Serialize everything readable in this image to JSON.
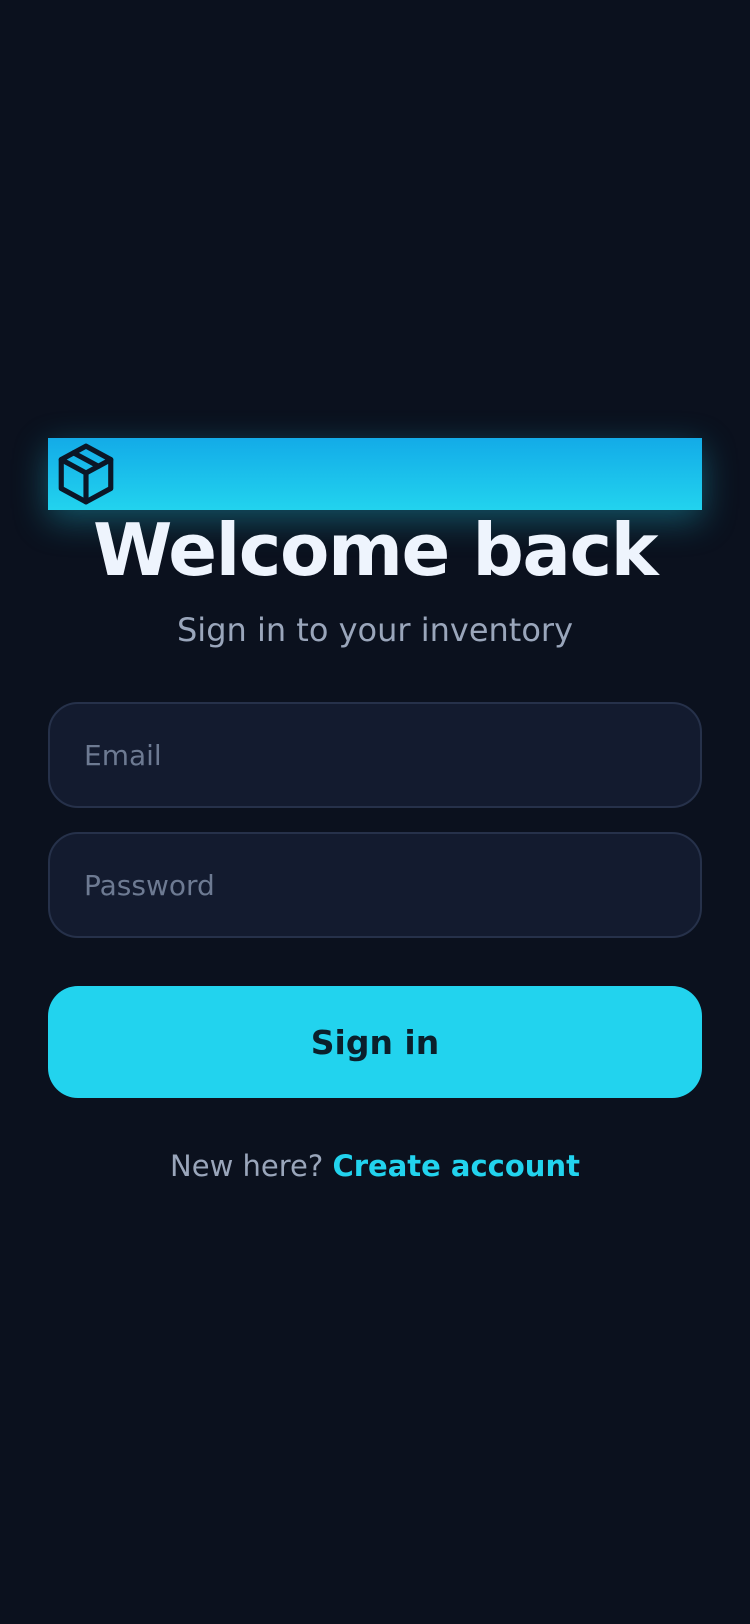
{
  "brand": {
    "icon": "package-icon",
    "accent_color": "#22d3ee"
  },
  "header": {
    "title": "Welcome back",
    "subtitle": "Sign in to your inventory"
  },
  "form": {
    "email": {
      "value": "",
      "placeholder": "Email"
    },
    "password": {
      "value": "",
      "placeholder": "Password"
    },
    "submit_label": "Sign in"
  },
  "footer": {
    "prompt": "New here?",
    "link_label": "Create account"
  },
  "colors": {
    "background": "#0b111e",
    "accent": "#22d3ee",
    "field_background": "#131b2f",
    "text_primary": "#eef4fd",
    "text_secondary": "#9aa6bb"
  }
}
